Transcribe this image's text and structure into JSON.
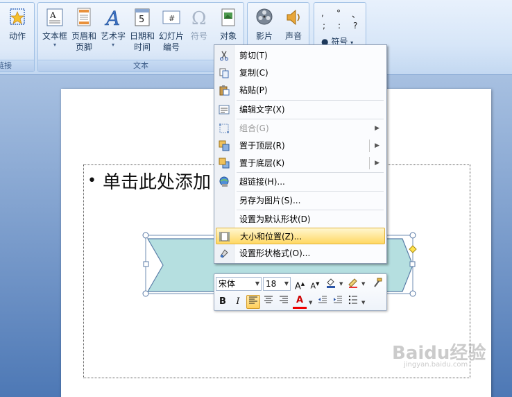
{
  "ribbon": {
    "groups": {
      "links": {
        "label": "链接",
        "action_label": "动作"
      },
      "text": {
        "label": "文本",
        "textbox_label": "文本框",
        "header_footer_label": "页眉和\n页脚",
        "wordart_label": "艺术字",
        "datetime_label": "日期和\n时间",
        "slide_number_label": "幻灯片\n编号",
        "symbol_label": "符号",
        "object_label": "对象"
      },
      "media": {
        "movie_label": "影片",
        "sound_label": "声音"
      },
      "special": {
        "symbol_label": "符号",
        "chars": [
          ",",
          "°",
          "、",
          ";",
          ":",
          "?"
        ]
      }
    }
  },
  "slide": {
    "bullet_text": "单击此处添加"
  },
  "context_menu": {
    "items": [
      {
        "label": "剪切(T)",
        "icon": "scissors-icon",
        "disabled": false
      },
      {
        "label": "复制(C)",
        "icon": "copy-icon",
        "disabled": false
      },
      {
        "label": "粘贴(P)",
        "icon": "paste-icon",
        "disabled": false
      },
      {
        "label": "编辑文字(X)",
        "icon": "edit-text-icon",
        "disabled": false
      },
      {
        "label": "组合(G)",
        "icon": "group-icon",
        "disabled": true
      },
      {
        "label": "置于顶层(R)",
        "icon": "bring-to-front-icon",
        "disabled": false
      },
      {
        "label": "置于底层(K)",
        "icon": "send-to-back-icon",
        "disabled": false
      },
      {
        "label": "超链接(H)...",
        "icon": "hyperlink-icon",
        "disabled": false
      },
      {
        "label": "另存为图片(S)...",
        "icon": "",
        "disabled": false
      },
      {
        "label": "设置为默认形状(D)",
        "icon": "",
        "disabled": false
      },
      {
        "label": "大小和位置(Z)...",
        "icon": "size-position-icon",
        "disabled": false
      },
      {
        "label": "设置形状格式(O)...",
        "icon": "format-shape-icon",
        "disabled": false
      }
    ]
  },
  "mini_toolbar": {
    "font_name": "宋体",
    "font_size": "18",
    "bold": "B",
    "italic": "I",
    "font_color": "A"
  },
  "watermark": {
    "text": "Baidu经验",
    "sub": "jingyan.baidu.com"
  },
  "colors": {
    "shape_fill": "#b5dfe0",
    "highlight": "#ffd863",
    "ribbon_border": "#9fbfe4"
  }
}
